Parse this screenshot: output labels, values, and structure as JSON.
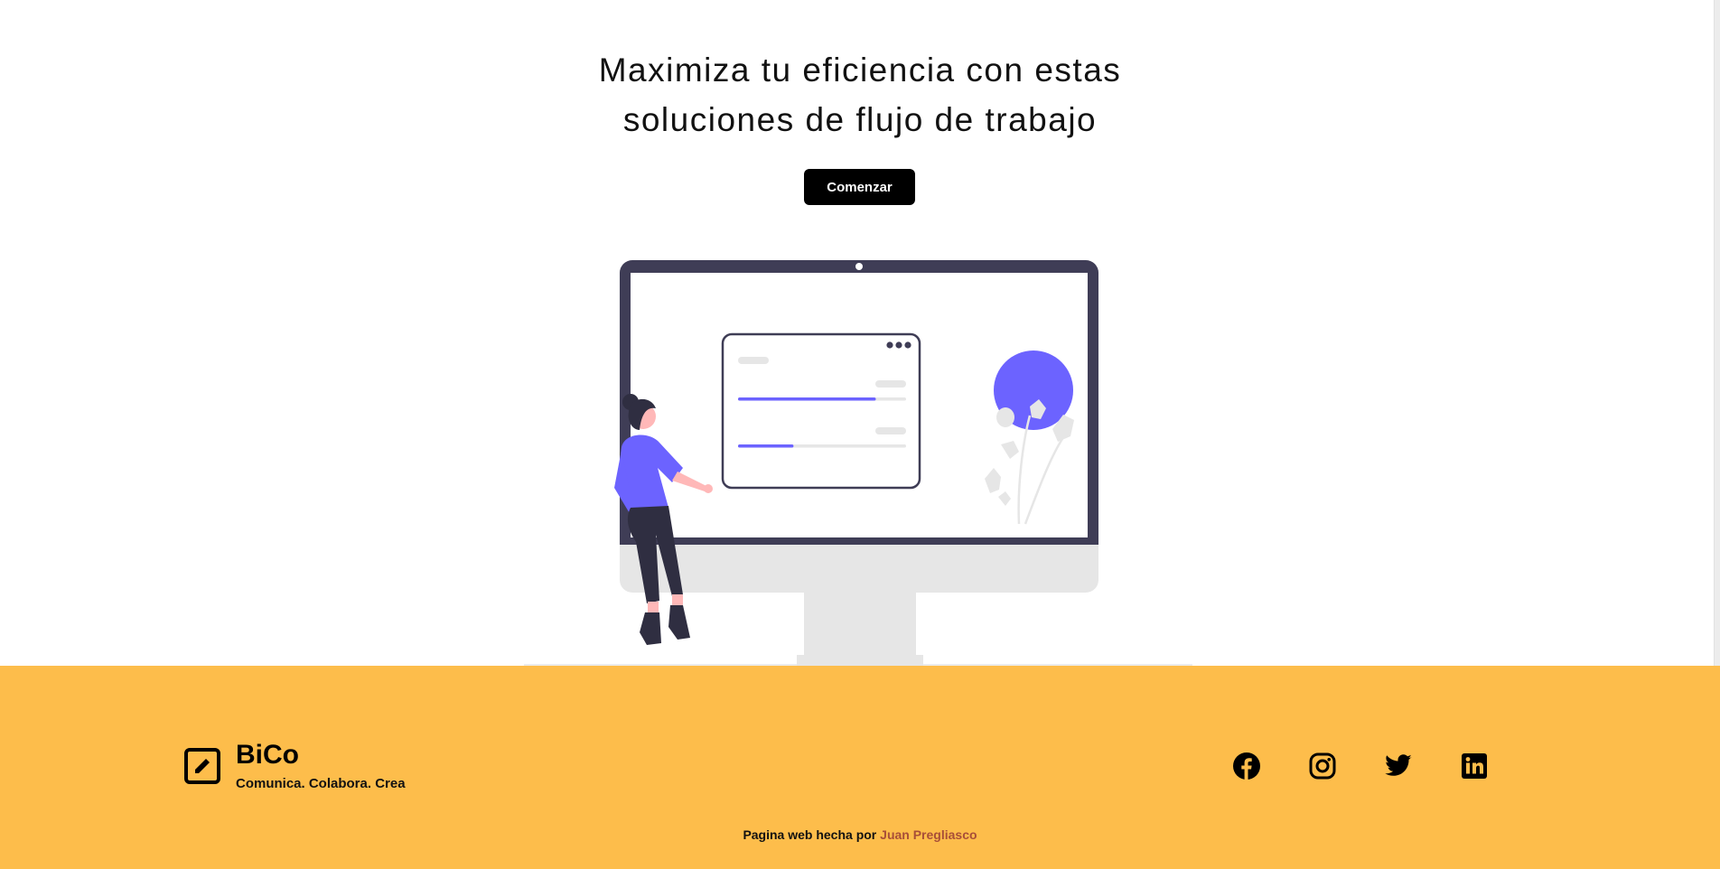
{
  "hero": {
    "title_line1": "Maximiza tu eficiencia con estas",
    "title_line2": "soluciones de flujo de trabajo",
    "cta_label": "Comenzar"
  },
  "colors": {
    "accent_purple": "#6c63ff",
    "monitor_dark": "#3f3d56",
    "footer_bg": "#fdbd4b",
    "link_color": "#a84e38",
    "button_bg": "#000000"
  },
  "footer": {
    "brand_name": "BiCo",
    "tagline": "Comunica. Colabora. Crea",
    "social_icons": [
      "facebook-icon",
      "instagram-icon",
      "twitter-icon",
      "linkedin-icon"
    ],
    "credit_prefix": "Pagina web hecha por",
    "credit_author": "Juan Pregliasco"
  },
  "illustration": {
    "progress_bars": [
      0.82,
      0.33
    ]
  }
}
